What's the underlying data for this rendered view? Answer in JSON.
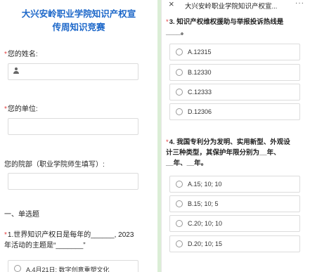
{
  "left": {
    "title_line1": "大兴安岭职业学院知识产权宣",
    "title_line2": "传周知识竞赛",
    "name_label": "您的姓名:",
    "unit_label": "您的单位:",
    "dept_label": "您的院部（职业学院师生填写）:",
    "section_label": "一、单选题",
    "q1_number": "1.",
    "q1_text_line1": "世界知识产权日是每年的______, 2023",
    "q1_text_line2": "年活动的主题是“_______”",
    "q1_optA": "A.4月21日; 数字创意重塑文化"
  },
  "right": {
    "topbar_title": "大兴安岭职业学院知识产权宣...",
    "topbar_more": "···",
    "q3_number": "3.",
    "q3_line1": "知识产权维权援助与举报投诉热线是",
    "q3_line2": "____。",
    "q3_options": [
      "A.12315",
      "B.12330",
      "C.12333",
      "D.12306"
    ],
    "q4_number": "4.",
    "q4_line1": "我国专利分为发明、实用新型、外观设",
    "q4_line2": "计三种类型，其保护年限分别为__年、",
    "q4_line3": "__年、__年。",
    "q4_options": [
      "A.15; 10; 10",
      "B.15; 10; 5",
      "C.20; 10; 10",
      "D.20; 10; 15"
    ]
  },
  "required_mark": "*",
  "colors": {
    "title_blue": "#1c67c9",
    "required_red": "#e23c3c",
    "bg_green": "#dbeed6"
  }
}
